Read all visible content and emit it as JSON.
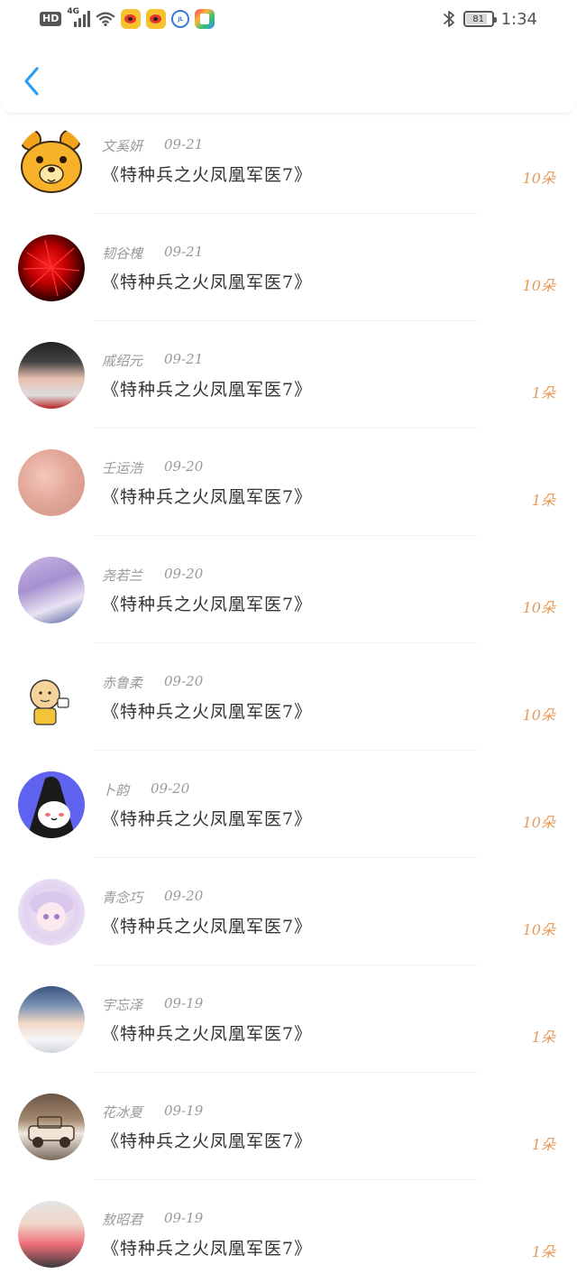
{
  "status_bar": {
    "hd_label": "HD",
    "network_label": "4G",
    "battery": "81",
    "time": "1:34",
    "icons": [
      "hd-icon",
      "signal-icon",
      "wifi-icon",
      "weibo-icon",
      "weibo-icon",
      "round-app-icon",
      "multicolor-app-icon",
      "bluetooth-icon",
      "battery-icon"
    ]
  },
  "header": {
    "back_icon": "chevron-left-icon",
    "accent": "#2a9df4"
  },
  "list": {
    "count_color": "#e69a5a",
    "items": [
      {
        "name": "文奚妍",
        "date": "09-21",
        "title": "《特种兵之火凤凰军医7》",
        "count": "10朵",
        "avatar": "bear"
      },
      {
        "name": "韧谷槐",
        "date": "09-21",
        "title": "《特种兵之火凤凰军医7》",
        "count": "10朵",
        "avatar": "red-flower"
      },
      {
        "name": "戚绍元",
        "date": "09-21",
        "title": "《特种兵之火凤凰军医7》",
        "count": "1朵",
        "avatar": "girl-photo"
      },
      {
        "name": "壬运浩",
        "date": "09-20",
        "title": "《特种兵之火凤凰军医7》",
        "count": "1朵",
        "avatar": "pink-photo"
      },
      {
        "name": "尧若兰",
        "date": "09-20",
        "title": "《特种兵之火凤凰军医7》",
        "count": "10朵",
        "avatar": "anime-girl"
      },
      {
        "name": "赤鲁柔",
        "date": "09-20",
        "title": "《特种兵之火凤凰军医7》",
        "count": "10朵",
        "avatar": "monk-cartoon"
      },
      {
        "name": "卜韵",
        "date": "09-20",
        "title": "《特种兵之火凤凰军医7》",
        "count": "10朵",
        "avatar": "witch-cartoon"
      },
      {
        "name": "青念巧",
        "date": "09-20",
        "title": "《特种兵之火凤凰军医7》",
        "count": "10朵",
        "avatar": "anime-girl-pastel"
      },
      {
        "name": "宇忘泽",
        "date": "09-19",
        "title": "《特种兵之火凤凰军医7》",
        "count": "1朵",
        "avatar": "girl-selfie"
      },
      {
        "name": "花冰夏",
        "date": "09-19",
        "title": "《特种兵之火凤凰军医7》",
        "count": "1朵",
        "avatar": "vintage-car"
      },
      {
        "name": "敖昭君",
        "date": "09-19",
        "title": "《特种兵之火凤凰军医7》",
        "count": "1朵",
        "avatar": "girl-pink-dress"
      }
    ]
  }
}
